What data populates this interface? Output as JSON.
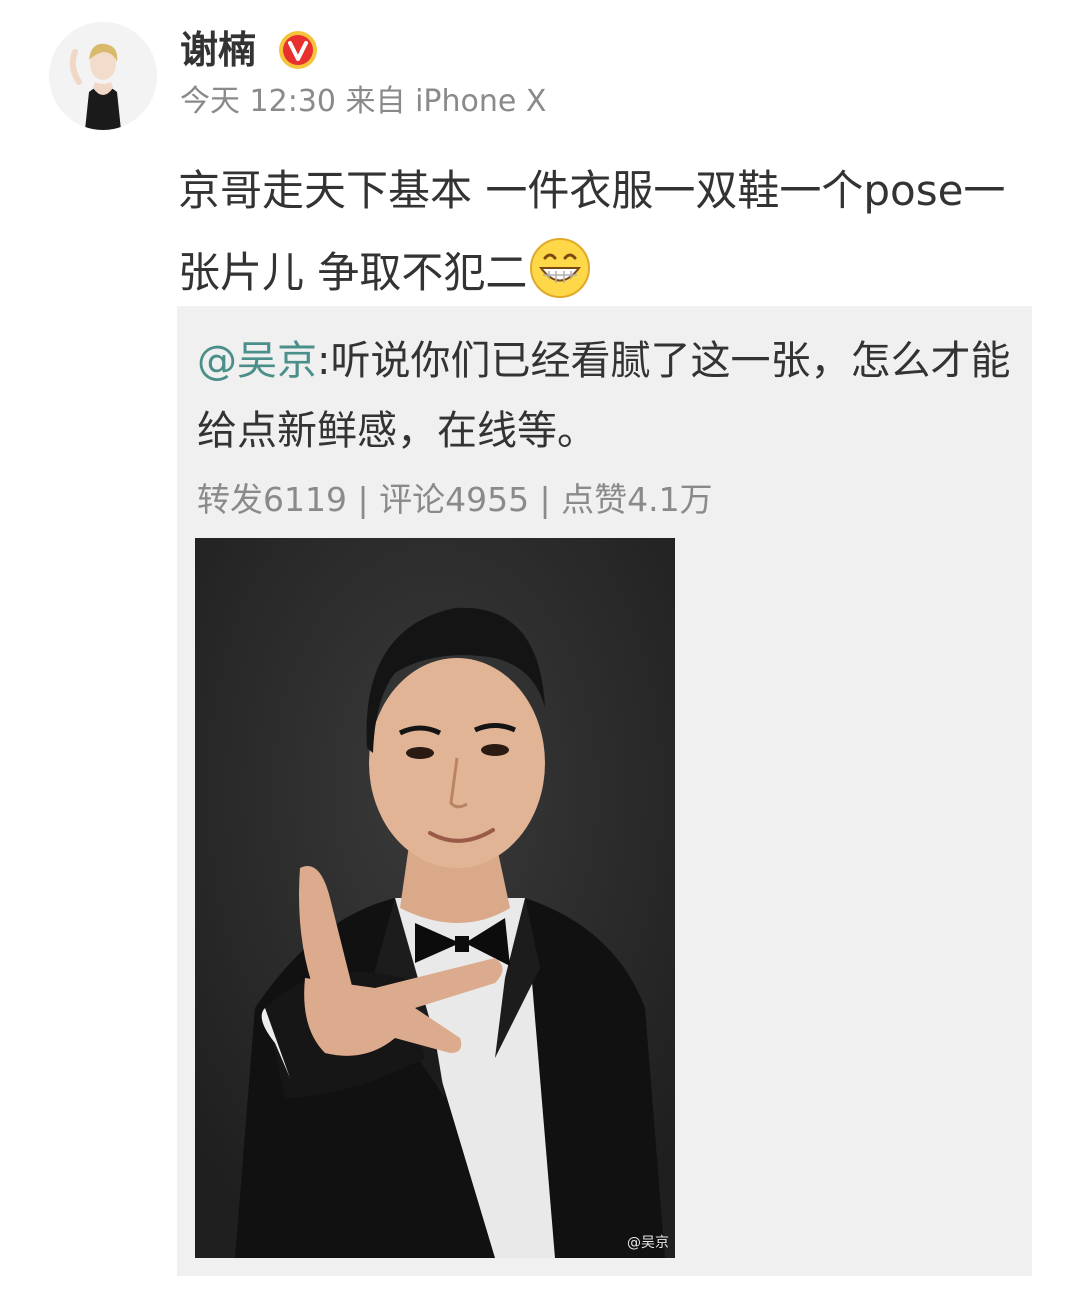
{
  "post": {
    "author": "谢楠",
    "verified_badge_icon": "verified-v-badge-icon",
    "time": "今天 12:30",
    "source": "来自 iPhone X",
    "text": "京哥走天下基本 一件衣服一双鞋一个pose一张片儿 争取不犯二",
    "emoji_icon": "grin-emoji-icon"
  },
  "repost": {
    "mention": "@吴京",
    "text": ":听说你们已经看腻了这一张，怎么才能给点新鲜感，在线等。",
    "stats": "转发6119 | 评论4955 | 点赞4.1万",
    "image_watermark": "@吴京"
  },
  "colors": {
    "mention": "#4a8f8a",
    "meta": "#8a8a8a",
    "repost_bg": "#f0f0f0",
    "badge": "#e8312f"
  }
}
